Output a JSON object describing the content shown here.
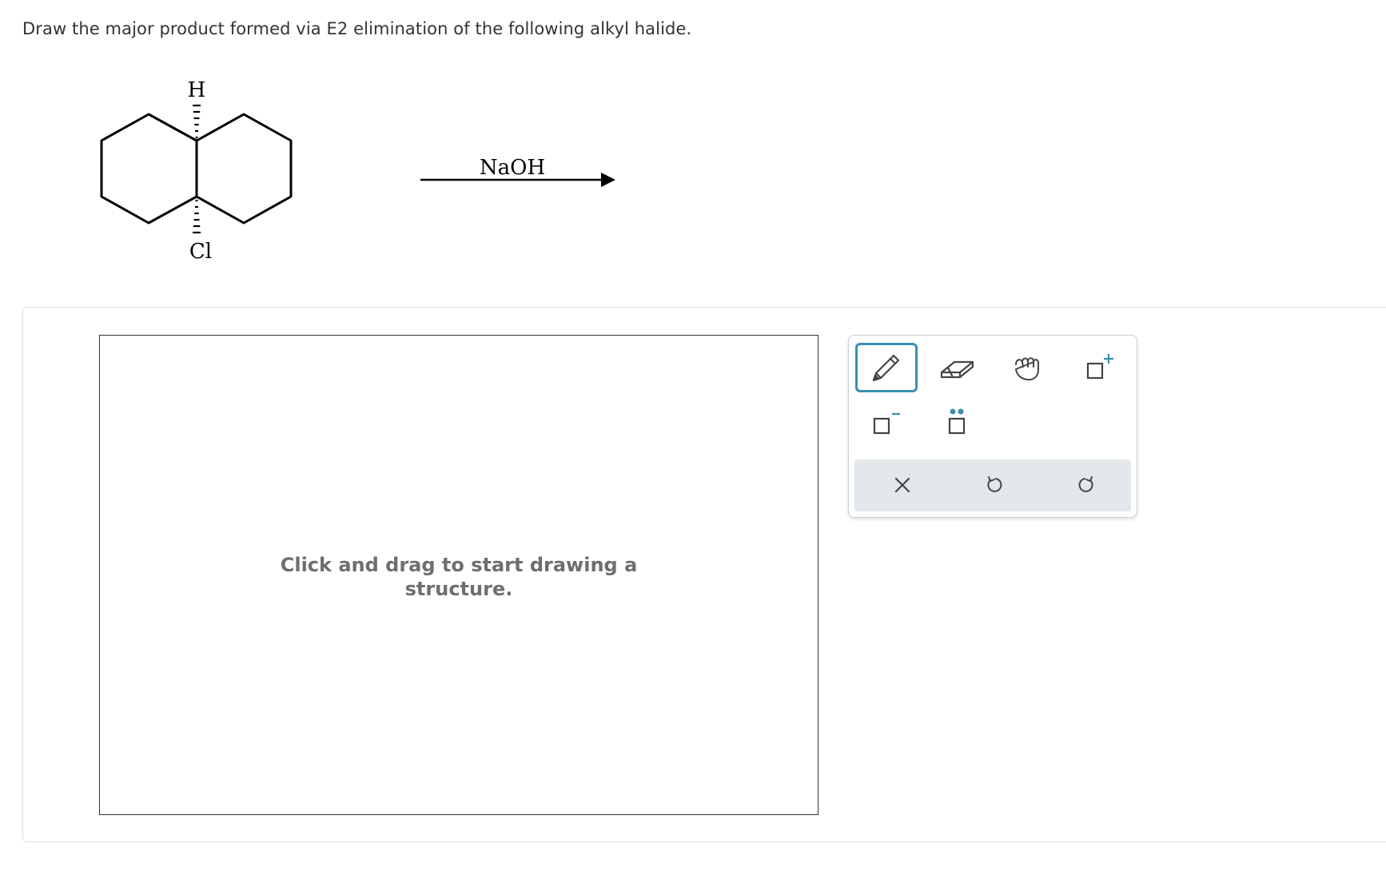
{
  "question": {
    "text": "Draw the major product formed via E2 elimination of the following alkyl halide."
  },
  "reaction": {
    "substituent_top": "H",
    "substituent_bottom": "Cl",
    "reagent": "NaOH"
  },
  "canvas": {
    "hint_line1": "Click and drag to start drawing a",
    "hint_line2": "structure."
  },
  "toolbar": {
    "tools": [
      {
        "name": "draw-tool",
        "icon": "pencil-icon",
        "selected": true
      },
      {
        "name": "erase-tool",
        "icon": "eraser-icon",
        "selected": false
      },
      {
        "name": "move-tool",
        "icon": "hand-icon",
        "selected": false
      },
      {
        "name": "add-positive-charge-tool",
        "icon": "positive-charge-icon",
        "selected": false
      },
      {
        "name": "add-negative-charge-tool",
        "icon": "negative-charge-icon",
        "selected": false
      },
      {
        "name": "add-lone-pair-tool",
        "icon": "lone-pair-icon",
        "selected": false
      }
    ],
    "actions": [
      {
        "name": "clear-button",
        "icon": "close-icon"
      },
      {
        "name": "undo-button",
        "icon": "undo-icon"
      },
      {
        "name": "redo-button",
        "icon": "redo-icon"
      }
    ],
    "accent_color": "#3a8fb0",
    "charge_plus_color": "#3a8fb0",
    "lone_pair_color": "#3a8fb0"
  }
}
